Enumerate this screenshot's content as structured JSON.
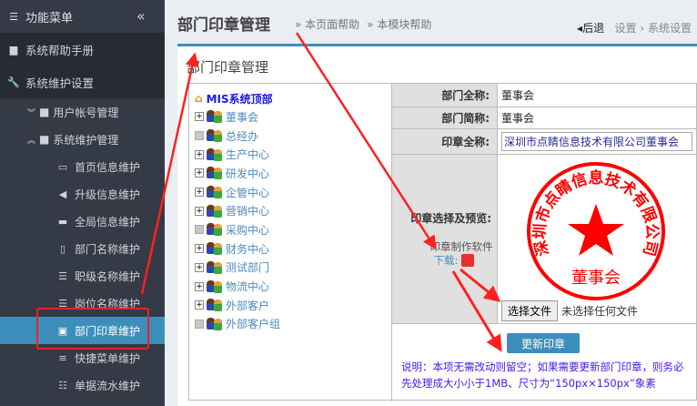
{
  "sidebar": {
    "title": "功能菜单",
    "top_items": [
      {
        "label": "系统帮助手册",
        "icon": "book-icon"
      },
      {
        "label": "系统维护设置",
        "icon": "wrench-icon"
      }
    ],
    "groups": [
      {
        "label": "用户帐号管理",
        "expanded": false
      },
      {
        "label": "系统维护管理",
        "expanded": true
      }
    ],
    "items": [
      {
        "label": "首页信息维护",
        "icon": "monitor-icon"
      },
      {
        "label": "升级信息维护",
        "icon": "megaphone-icon"
      },
      {
        "label": "全局信息维护",
        "icon": "desktop-icon"
      },
      {
        "label": "部门名称维护",
        "icon": "building-icon"
      },
      {
        "label": "职级名称维护",
        "icon": "list-icon"
      },
      {
        "label": "岗位名称维护",
        "icon": "list-icon"
      },
      {
        "label": "部门印章维护",
        "icon": "id-card-icon",
        "active": true
      },
      {
        "label": "快捷菜单维护",
        "icon": "bars-icon"
      },
      {
        "label": "单据流水维护",
        "icon": "list-ol-icon"
      }
    ]
  },
  "header": {
    "title": "部门印章管理",
    "help_page": "» 本页面帮助",
    "help_module": "» 本模块帮助",
    "back": "后退",
    "crumb1": "设置",
    "crumb2": "系统设置"
  },
  "panel": {
    "title": "部门印章管理"
  },
  "tree": {
    "root": "MIS系统顶部",
    "nodes": [
      {
        "label": "董事会",
        "expandable": true
      },
      {
        "label": "总经办",
        "expandable": false
      },
      {
        "label": "生产中心",
        "expandable": true
      },
      {
        "label": "研发中心",
        "expandable": true
      },
      {
        "label": "企管中心",
        "expandable": true
      },
      {
        "label": "营销中心",
        "expandable": true
      },
      {
        "label": "采购中心",
        "expandable": false
      },
      {
        "label": "财务中心",
        "expandable": true
      },
      {
        "label": "测试部门",
        "expandable": true
      },
      {
        "label": "物流中心",
        "expandable": true
      },
      {
        "label": "外部客户",
        "expandable": true
      },
      {
        "label": "外部客户组",
        "expandable": false
      }
    ]
  },
  "form": {
    "full_name_label": "部门全称:",
    "full_name": "董事会",
    "short_name_label": "部门简称:",
    "short_name": "董事会",
    "seal_name_label": "印章全称:",
    "seal_name": "深圳市点睛信息技术有限公司董事会",
    "seal_preview_label": "印章选择及预览:",
    "software_text": "印章制作软件",
    "download_text": "下载:",
    "choose_file": "选择文件",
    "no_file": "未选择任何文件",
    "update_button": "更新印章",
    "note": "说明：本项无需改动则留空；如果需要更新部门印章，则务必先处理成大小小于1MB、尺寸为“150px×150px”象素"
  },
  "seal": {
    "ring_text": "深圳市点睛信息技术有限公司",
    "center_text": "董事会",
    "color": "#ff0000"
  },
  "colors": {
    "accent": "#3d8fbb",
    "sidebar": "#343a46",
    "annotation": "#ff2020"
  }
}
